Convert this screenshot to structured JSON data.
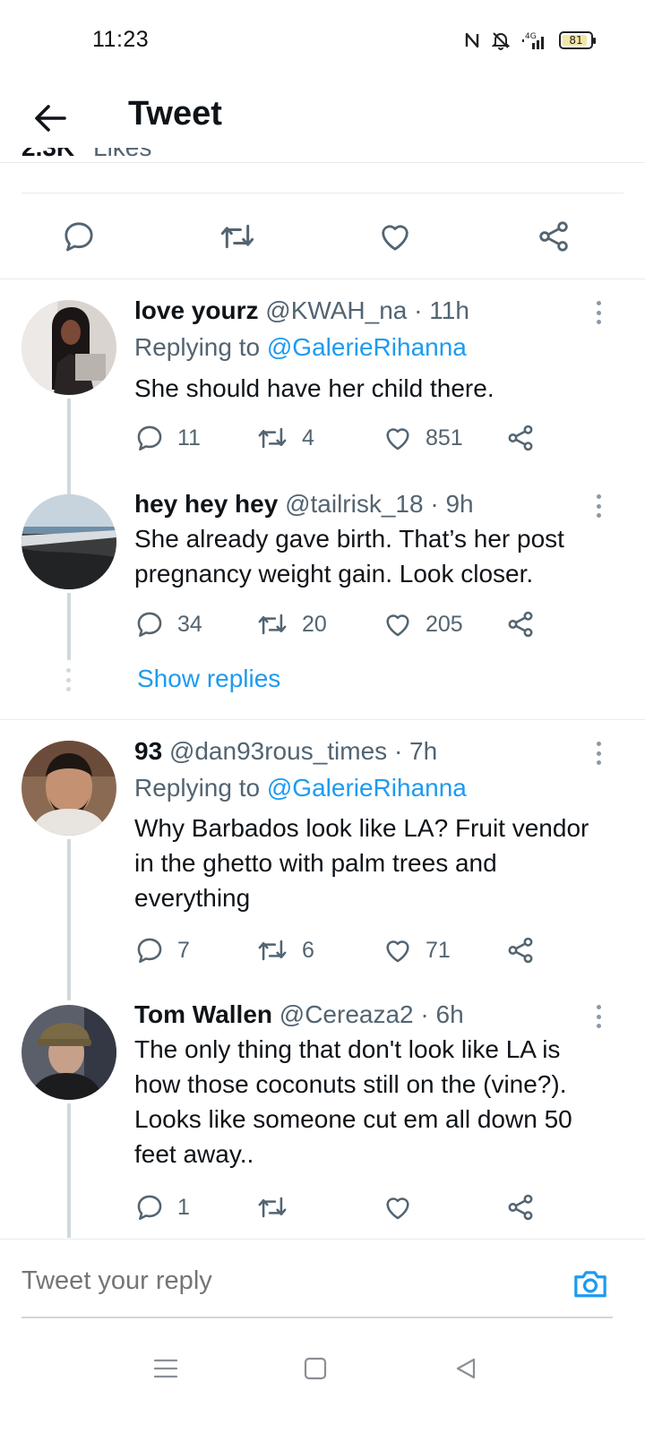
{
  "status_bar": {
    "time": "11:23",
    "network": "4G",
    "battery": "81",
    "icons": [
      "nfc-icon",
      "mute-icon",
      "signal-icon",
      "battery-icon"
    ]
  },
  "header": {
    "back_icon": "arrow-left-icon",
    "title": "Tweet"
  },
  "main_tweet": {
    "likes_count_cut": "2.3K",
    "likes_label_cut": "Likes",
    "actions": [
      "reply-icon",
      "retweet-icon",
      "like-icon",
      "share-icon"
    ]
  },
  "replies": [
    {
      "name": "love yourz",
      "handle": "@KWAH_na",
      "time": "· 11h",
      "replying_prefix": "Replying to",
      "replying_to": "@GalerieRihanna",
      "text_lines": [
        "She should have her child there."
      ],
      "reply_count": "11",
      "retweet_count": "4",
      "like_count": "851"
    },
    {
      "name": "hey hey hey",
      "handle": "@tailrisk_18",
      "time": "· 9h",
      "text_lines": [
        "She already gave birth. That’s her post",
        "pregnancy weight gain. Look closer."
      ],
      "reply_count": "34",
      "retweet_count": "20",
      "like_count": "205"
    },
    {
      "name": "93",
      "handle": "@dan93rous_times",
      "time": "· 7h",
      "replying_prefix": "Replying to",
      "replying_to": "@GalerieRihanna",
      "text_lines": [
        "Why Barbados look like LA? Fruit vendor",
        "in the ghetto with palm trees and",
        "everything"
      ],
      "reply_count": "7",
      "retweet_count": "6",
      "like_count": "71"
    },
    {
      "name": "Tom Wallen",
      "handle": "@Cereaza2",
      "time": "· 6h",
      "text_lines": [
        "The only thing that don't look like LA is",
        "how those coconuts still on the (vine?).",
        "Looks like someone cut em all down 50",
        "feet away.."
      ],
      "reply_count": "1",
      "retweet_count": "",
      "like_count": ""
    }
  ],
  "show_replies": "Show replies",
  "composer": {
    "placeholder": "Tweet your reply",
    "camera_icon": "camera-icon"
  },
  "navbar": [
    "menu-icon",
    "home-square-icon",
    "back-triangle-icon"
  ],
  "colors": {
    "accent": "#1d9bf0",
    "text_primary": "#0f1419",
    "text_secondary": "#536471",
    "divider": "#e6ecf0"
  }
}
